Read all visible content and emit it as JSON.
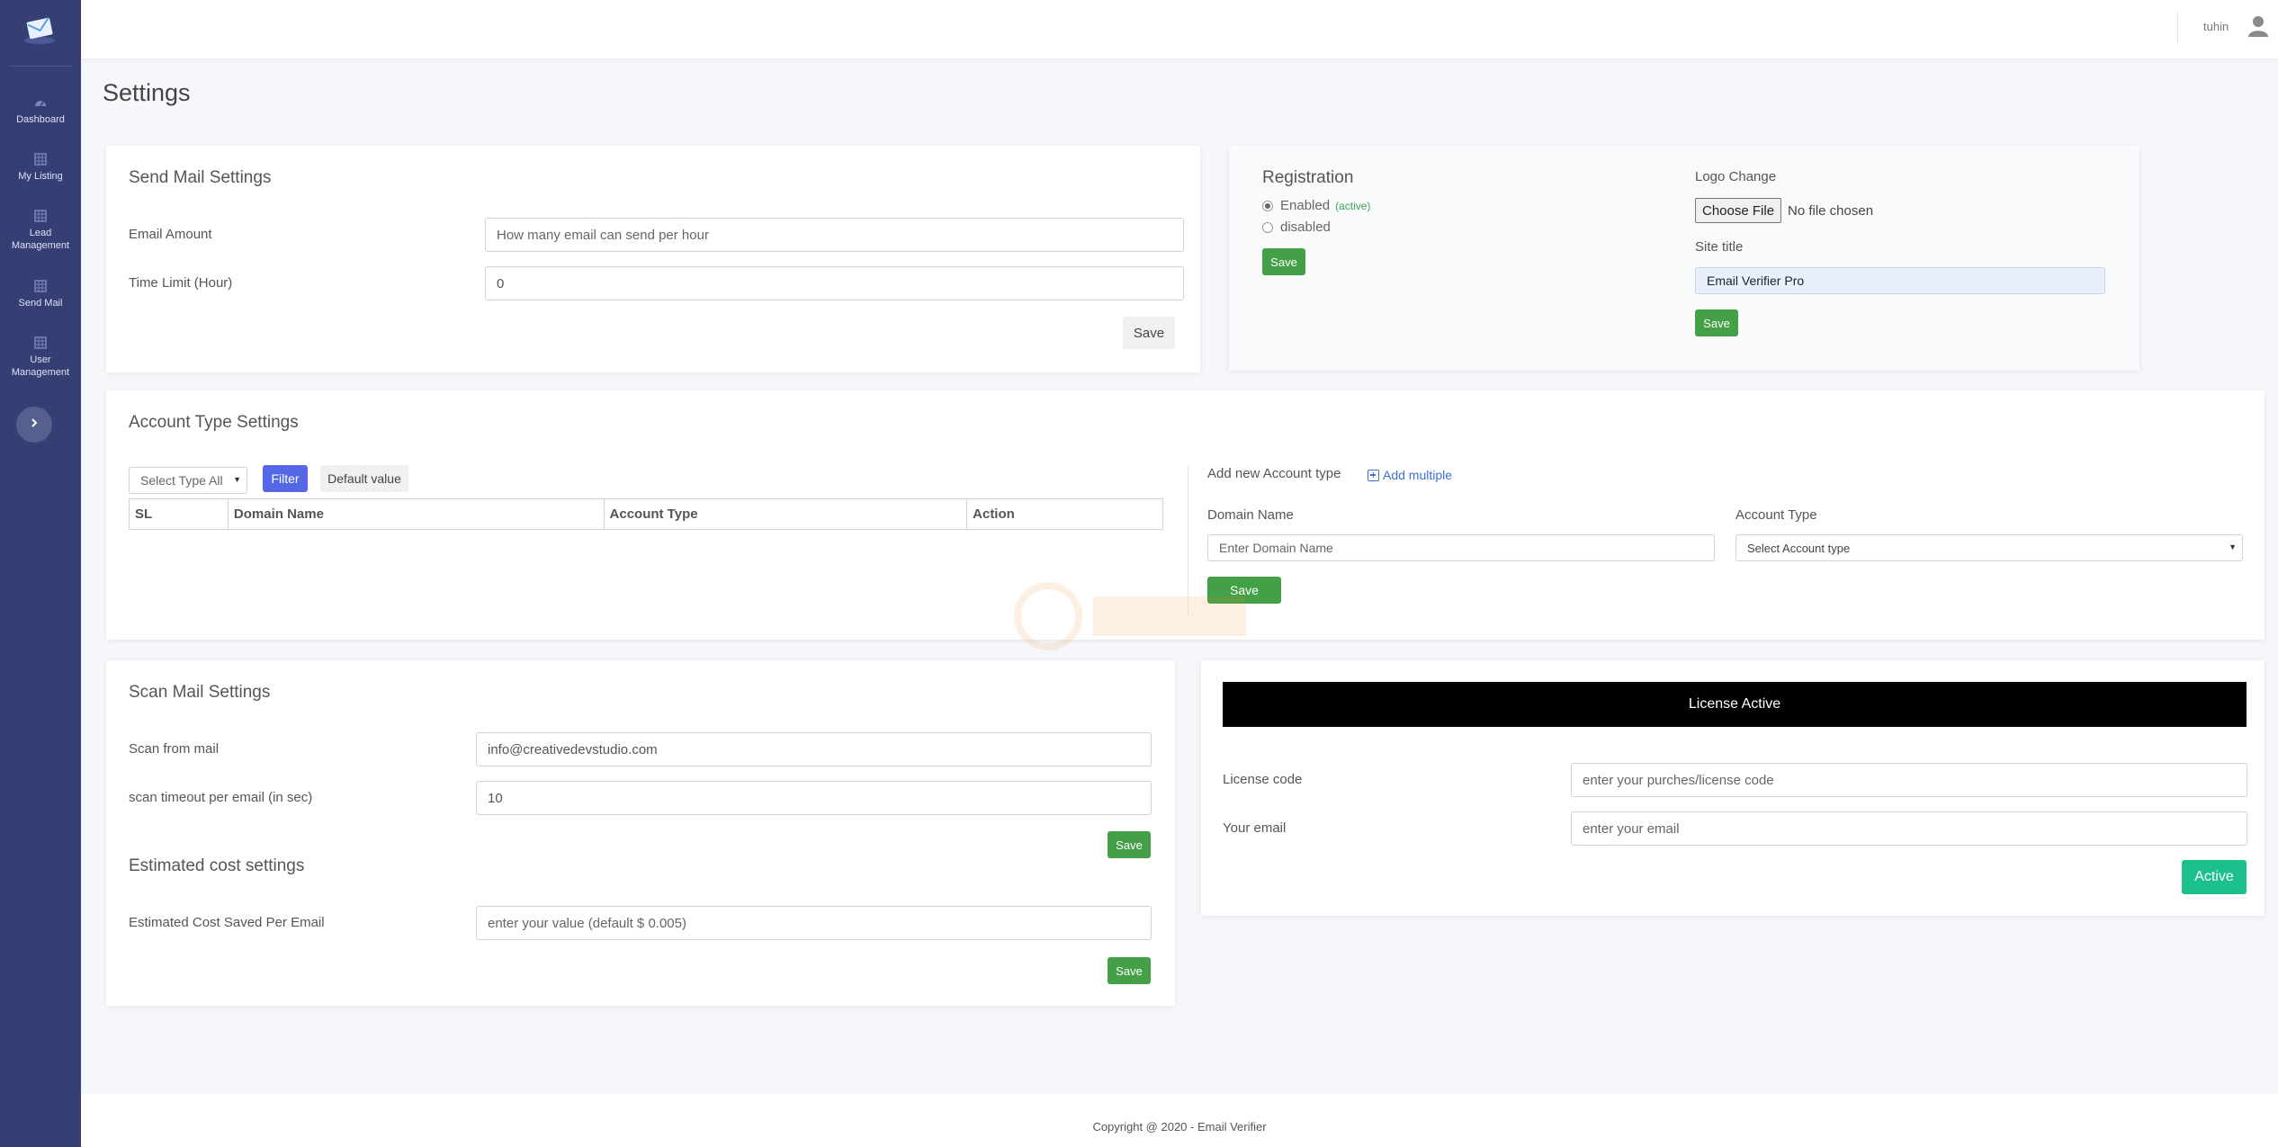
{
  "sidebar": {
    "items": [
      {
        "label": "Dashboard",
        "icon": "dashboard-icon"
      },
      {
        "label": "My Listing",
        "icon": "table-icon"
      },
      {
        "label": "Lead Management",
        "icon": "table-icon"
      },
      {
        "label": "Send Mail",
        "icon": "table-icon"
      },
      {
        "label": "User Management",
        "icon": "table-icon"
      }
    ],
    "toggle_icon": "chevron-right-icon"
  },
  "header": {
    "username": "tuhin",
    "avatar_icon": "user-icon"
  },
  "page": {
    "title": "Settings"
  },
  "send_mail": {
    "title": "Send Mail Settings",
    "email_amount_label": "Email Amount",
    "email_amount_placeholder": "How many email can send per hour",
    "time_limit_label": "Time Limit (Hour)",
    "time_limit_value": "0",
    "save_label": "Save"
  },
  "registration": {
    "title": "Registration",
    "enabled_label": "Enabled",
    "active_tag": "(active)",
    "disabled_label": "disabled",
    "selected": "enabled",
    "save_label": "Save",
    "logo_change_label": "Logo Change",
    "choose_file_label": "Choose File",
    "no_file_label": "No file chosen",
    "site_title_label": "Site title",
    "site_title_value": "Email Verifier Pro",
    "save2_label": "Save"
  },
  "account_types": {
    "title": "Account Type Settings",
    "filter_select": "Select Type All",
    "filter_label": "Filter",
    "default_label": "Default value",
    "columns": [
      "SL",
      "Domain Name",
      "Account Type",
      "Action"
    ],
    "add_title": "Add new Account type",
    "add_multiple_label": "Add multiple",
    "domain_label": "Domain Name",
    "domain_placeholder": "Enter Domain Name",
    "account_type_label": "Account Type",
    "account_type_select": "Select Account type",
    "save_label": "Save"
  },
  "scan_mail": {
    "title": "Scan Mail Settings",
    "from_label": "Scan from mail",
    "from_value": "info@creativedevstudio.com",
    "timeout_label": "scan timeout per email (in sec)",
    "timeout_value": "10",
    "save_label": "Save",
    "cost_title": "Estimated cost settings",
    "cost_label": "Estimated Cost Saved Per Email",
    "cost_placeholder": "enter your value (default $ 0.005)",
    "cost_save_label": "Save"
  },
  "license": {
    "banner": "License Active",
    "code_label": "License code",
    "code_placeholder": "enter your purches/license code",
    "email_label": "Your email",
    "email_placeholder": "enter your email",
    "active_label": "Active"
  },
  "footer": {
    "text": "Copyright @ 2020 - Email Verifier"
  },
  "colors": {
    "sidebar": "#363f73",
    "green": "#43a047",
    "blue": "#5468e7",
    "teal": "#1cc08c"
  }
}
